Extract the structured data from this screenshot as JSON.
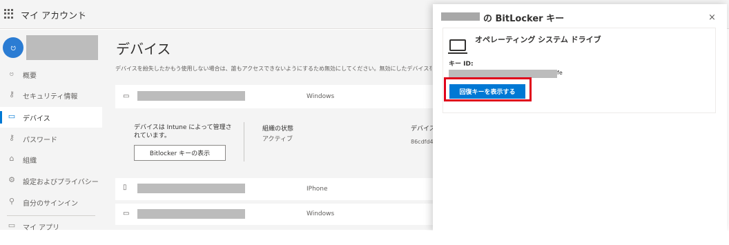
{
  "header": {
    "app_title": "マイ アカウント",
    "chevron": "⌵"
  },
  "user": {
    "avatar_glyph": "ဗ"
  },
  "sidebar": {
    "items": [
      {
        "icon": "person-icon",
        "glyph": "ဗ",
        "label": "概要"
      },
      {
        "icon": "security-info-icon",
        "glyph": "⚷",
        "label": "セキュリティ情報"
      },
      {
        "icon": "laptop-icon",
        "glyph": "▭",
        "label": "デバイス"
      },
      {
        "icon": "key-icon",
        "glyph": "⚷",
        "label": "パスワード"
      },
      {
        "icon": "organization-icon",
        "glyph": "⌂",
        "label": "組織"
      },
      {
        "icon": "gear-icon",
        "glyph": "⚙",
        "label": "設定およびプライバシー"
      },
      {
        "icon": "sign-in-icon",
        "glyph": "⚲",
        "label": "自分のサインイン"
      },
      {
        "icon": "apps-icon",
        "glyph": "▭",
        "label": "マイ アプリ"
      }
    ]
  },
  "main": {
    "title": "デバイス",
    "description": "デバイスを紛失したかもう使用しない場合は、誰もアクセスできないようにするため無効にしてください。無効にしたデバイスを再有効",
    "devices": [
      {
        "icon": "laptop-icon",
        "glyph": "▭",
        "os": "Windows"
      },
      {
        "icon": "phone-icon",
        "glyph": "▯",
        "os": "IPhone"
      },
      {
        "icon": "laptop-icon",
        "glyph": "▭",
        "os": "Windows"
      }
    ],
    "expanded": {
      "managed_text": "デバイスは Intune によって管理されています。",
      "bitlocker_button": "Bitlocker キーの表示",
      "org_status_label": "組織の状態",
      "org_status_value": "アクティブ",
      "device_label": "デバイス",
      "device_value": "86cdfd4"
    }
  },
  "panel": {
    "title": "の BitLocker キー",
    "close": "×",
    "drive_title": "オペレーティング システム ドライブ",
    "key_id_label": "キー ID:",
    "key_id_tail": "fe",
    "show_key_button": "回復キーを表示する",
    "accent_color": "#0078d4",
    "highlight_color": "#e0001a"
  }
}
